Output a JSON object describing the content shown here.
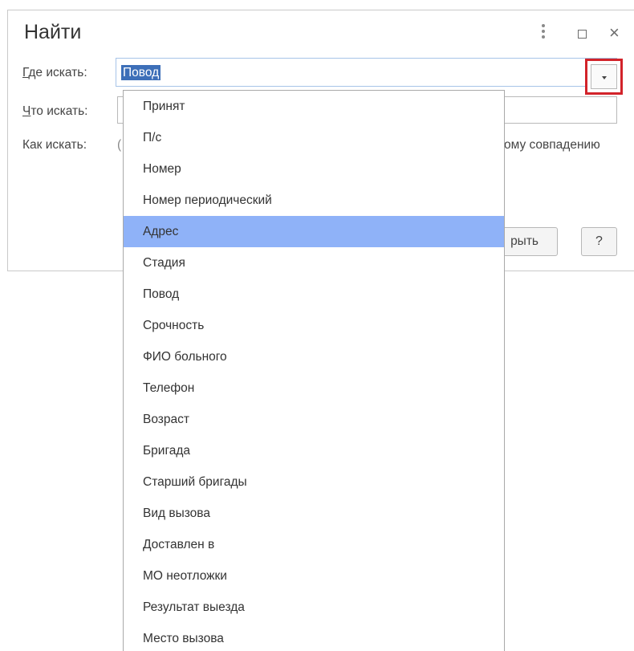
{
  "dialog": {
    "title": "Найти",
    "where_label_first": "Г",
    "where_label_rest": "де искать:",
    "where_value": "Повод",
    "what_label_first": "Ч",
    "what_label_rest": "то искать:",
    "how_label": "Как искать:",
    "how_partial_left": "(",
    "how_partial_right": "ому совпадению",
    "close_partial": "рыть",
    "help_label": "?"
  },
  "dropdown": {
    "selected_index": 4,
    "items": [
      "Принят",
      "П/с",
      "Номер",
      "Номер периодический",
      "Адрес",
      "Стадия",
      "Повод",
      "Срочность",
      "ФИО больного",
      "Телефон",
      "Возраст",
      "Бригада",
      "Старший бригады",
      "Вид вызова",
      "Доставлен в",
      "МО неотложки",
      "Результат выезда",
      "Место вызова"
    ]
  },
  "colors": {
    "highlight": "#8fb2f8",
    "selection": "#3d6fb8",
    "callout": "#d2232a"
  }
}
